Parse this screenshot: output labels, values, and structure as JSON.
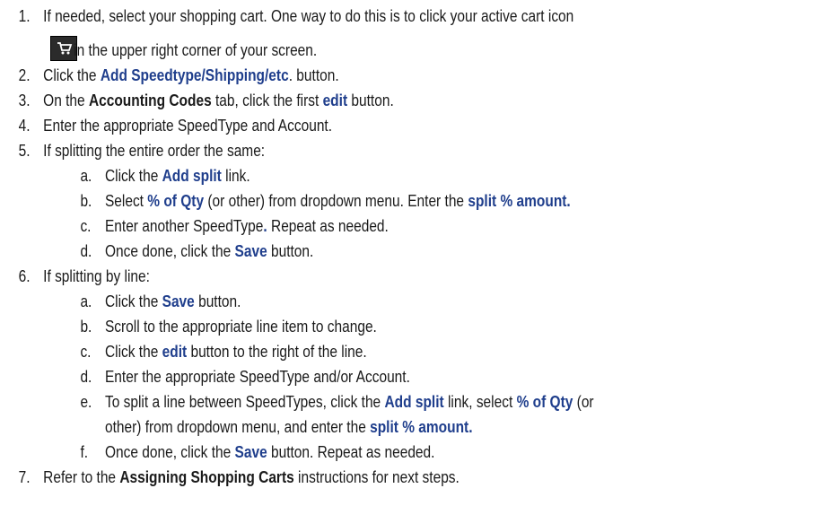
{
  "steps": {
    "s1": {
      "num": "1.",
      "a": "If needed, select your shopping cart. One way to do this is to click your active cart icon",
      "b": "in the upper right corner of your screen."
    },
    "s2": {
      "num": "2.",
      "a": "Click the ",
      "bold": "Add Speedtype/Shipping/etc",
      "c": ". button."
    },
    "s3": {
      "num": "3.",
      "a": "On the ",
      "bold1": "Accounting Codes",
      "b": " tab, click the first ",
      "bold2": "edit",
      "c": " button."
    },
    "s4": {
      "num": "4.",
      "a": "Enter the appropriate SpeedType and Account."
    },
    "s5": {
      "num": "5.",
      "a": "If splitting the entire order the same:",
      "sa": {
        "num": "a.",
        "a": "Click the ",
        "bold": "Add split",
        "c": " link."
      },
      "sb": {
        "num": "b.",
        "a": "Select ",
        "bold1": "% of Qty",
        "b": " (or other) from dropdown menu. Enter the ",
        "bold2": "split % amount."
      },
      "sc": {
        "num": "c.",
        "a": "Enter another SpeedType",
        "bold": ".",
        "c": " Repeat as needed."
      },
      "sd": {
        "num": "d.",
        "a": "Once done, click the ",
        "bold": "Save",
        "c": " button."
      }
    },
    "s6": {
      "num": "6.",
      "a": "If splitting by line:",
      "sa": {
        "num": "a.",
        "a": "Click the ",
        "bold": "Save",
        "c": " button."
      },
      "sb": {
        "num": "b.",
        "a": "Scroll to the appropriate line item to change."
      },
      "sc": {
        "num": "c.",
        "a": "Click the ",
        "bold": "edit",
        "c": " button to the right of the line."
      },
      "sd": {
        "num": "d.",
        "a": "Enter the appropriate SpeedType and/or Account."
      },
      "se": {
        "num": "e.",
        "a": "To split a line between SpeedTypes, click the ",
        "bold1": "Add split",
        "b": " link, select ",
        "bold2": "% of Qty",
        "c": " (or",
        "d": "other) from dropdown menu, and enter the ",
        "bold3": "split % amount."
      },
      "sf": {
        "num": "f.",
        "a": "Once done, click the ",
        "bold": "Save",
        "c": " button. Repeat as needed."
      }
    },
    "s7": {
      "num": "7.",
      "a": "Refer to the ",
      "bold": "Assigning Shopping Carts",
      "c": " instructions for next steps."
    }
  },
  "icons": {
    "cart": "shopping-cart-icon"
  },
  "colors": {
    "highlight": "#1f3e8c",
    "text": "#1a1a1a",
    "icon_bg": "#2b2b2b"
  }
}
